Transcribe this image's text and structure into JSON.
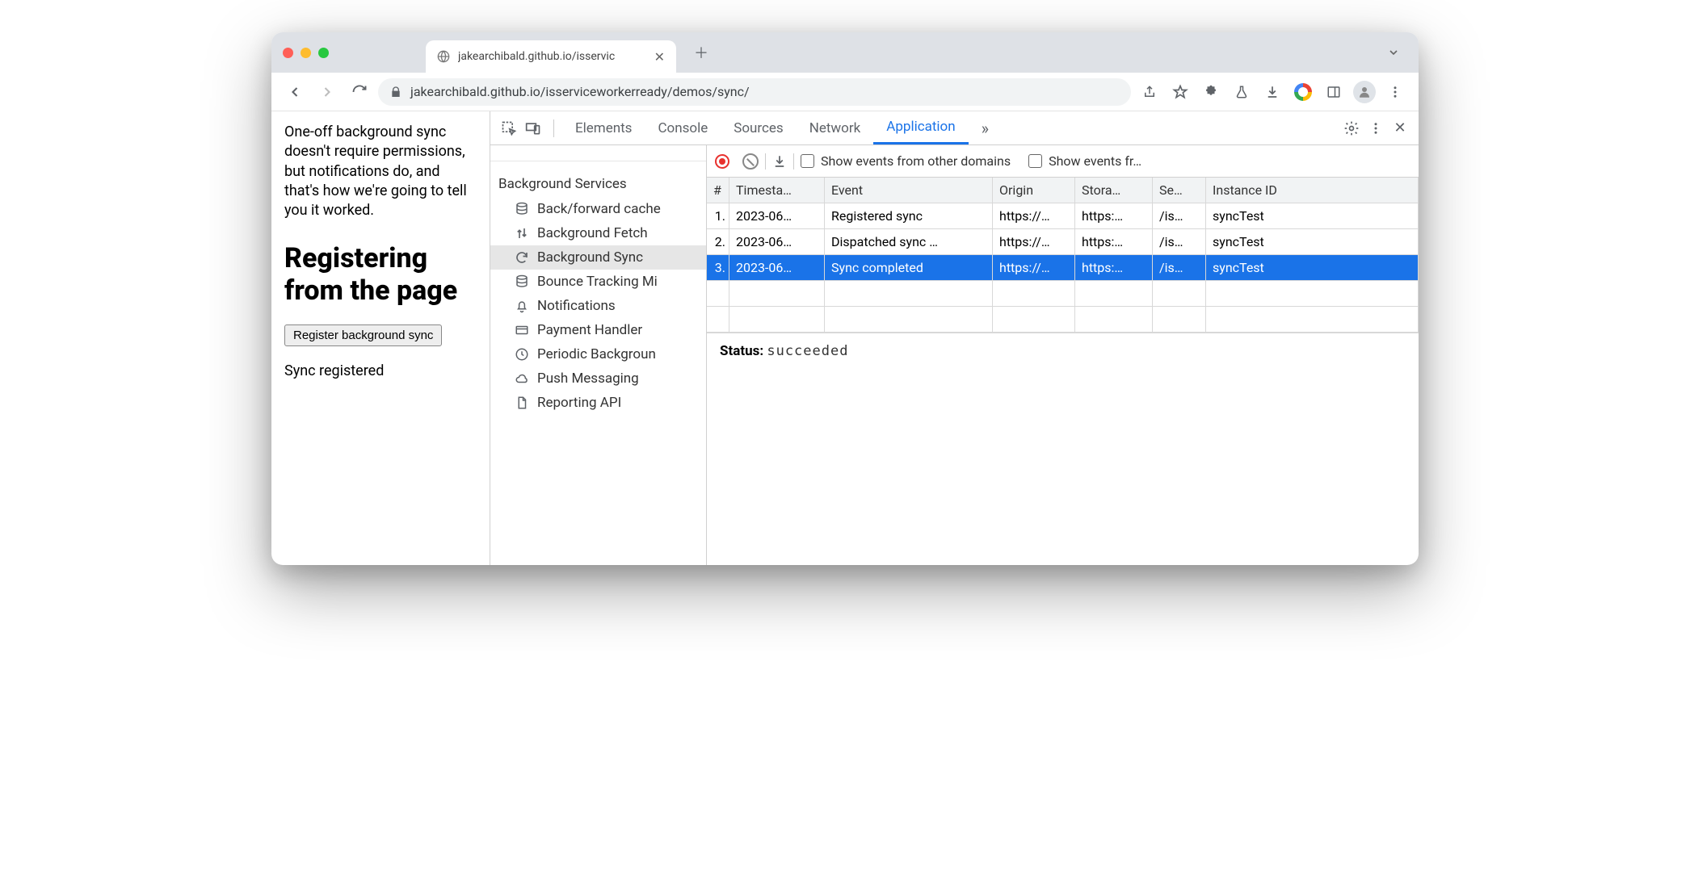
{
  "browser": {
    "tab_title": "jakearchibald.github.io/isservic",
    "url_display": "jakearchibald.github.io/isserviceworkerready/demos/sync/"
  },
  "page": {
    "intro": "One-off background sync doesn't require permissions, but notifications do, and that's how we're going to tell you it worked.",
    "heading": "Registering from the page",
    "button_label": "Register background sync",
    "status_text": "Sync registered"
  },
  "devtools": {
    "tabs": [
      "Elements",
      "Console",
      "Sources",
      "Network",
      "Application"
    ],
    "active_tab": "Application",
    "more_indicator": "»",
    "toolbar": {
      "show_other_domains_label": "Show events from other domains",
      "show_events_truncated_label": "Show events fr…"
    },
    "sidebar": {
      "group_label": "Background Services",
      "items": [
        {
          "icon": "database",
          "label": "Back/forward cache"
        },
        {
          "icon": "updown",
          "label": "Background Fetch"
        },
        {
          "icon": "sync",
          "label": "Background Sync",
          "selected": true
        },
        {
          "icon": "database",
          "label": "Bounce Tracking Mi"
        },
        {
          "icon": "bell",
          "label": "Notifications"
        },
        {
          "icon": "card",
          "label": "Payment Handler"
        },
        {
          "icon": "clock",
          "label": "Periodic Backgroun"
        },
        {
          "icon": "cloud",
          "label": "Push Messaging"
        },
        {
          "icon": "file",
          "label": "Reporting API"
        }
      ]
    },
    "table": {
      "columns": [
        "#",
        "Timesta…",
        "Event",
        "Origin",
        "Stora…",
        "Se…",
        "Instance ID"
      ],
      "rows": [
        {
          "n": "1.",
          "ts": "2023-06…",
          "event": "Registered sync",
          "origin": "https://…",
          "storage": "https:…",
          "scope": "/is…",
          "instance": "syncTest"
        },
        {
          "n": "2.",
          "ts": "2023-06…",
          "event": "Dispatched sync …",
          "origin": "https://…",
          "storage": "https:…",
          "scope": "/is…",
          "instance": "syncTest"
        },
        {
          "n": "3.",
          "ts": "2023-06…",
          "event": "Sync completed",
          "origin": "https://…",
          "storage": "https:…",
          "scope": "/is…",
          "instance": "syncTest",
          "selected": true
        }
      ]
    },
    "status": {
      "label": "Status:",
      "value": "succeeded"
    }
  }
}
